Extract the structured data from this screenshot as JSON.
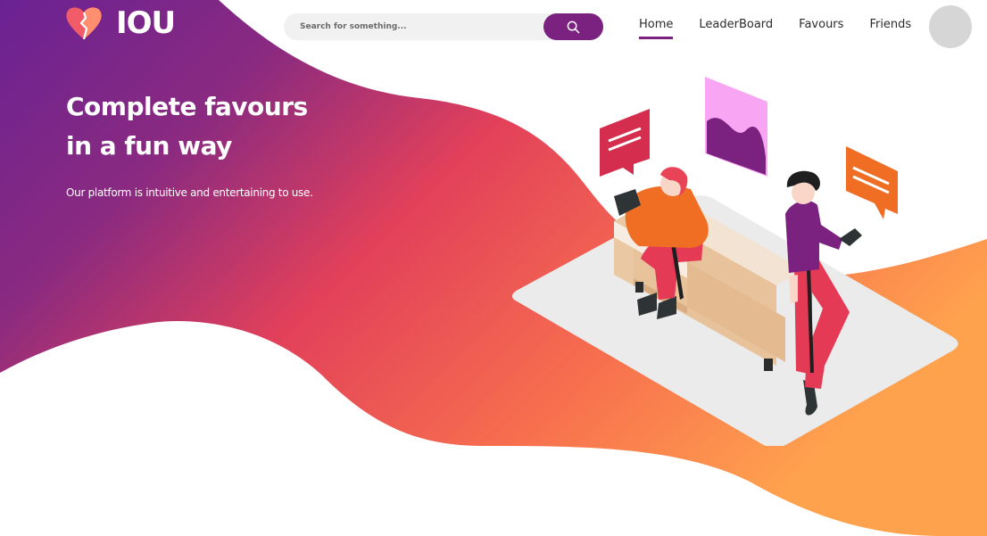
{
  "brand": {
    "name": "IOU",
    "logo_icon": "broken-heart-icon",
    "gradient": [
      "#6e2289",
      "#e84357",
      "#ff9a4e"
    ],
    "accent": "#7b2180"
  },
  "search": {
    "placeholder": "Search for something...",
    "value": "",
    "button_icon": "search-icon"
  },
  "nav": {
    "items": [
      {
        "label": "Home",
        "active": true
      },
      {
        "label": "LeaderBoard",
        "active": false
      },
      {
        "label": "Favours",
        "active": false
      },
      {
        "label": "Friends",
        "active": false
      }
    ]
  },
  "profile": {
    "avatar_icon": "user-avatar"
  },
  "hero": {
    "title_line1": "Complete favours",
    "title_line2": "in a fun way",
    "subtitle": "Our platform is intuitive and entertaining to use."
  }
}
